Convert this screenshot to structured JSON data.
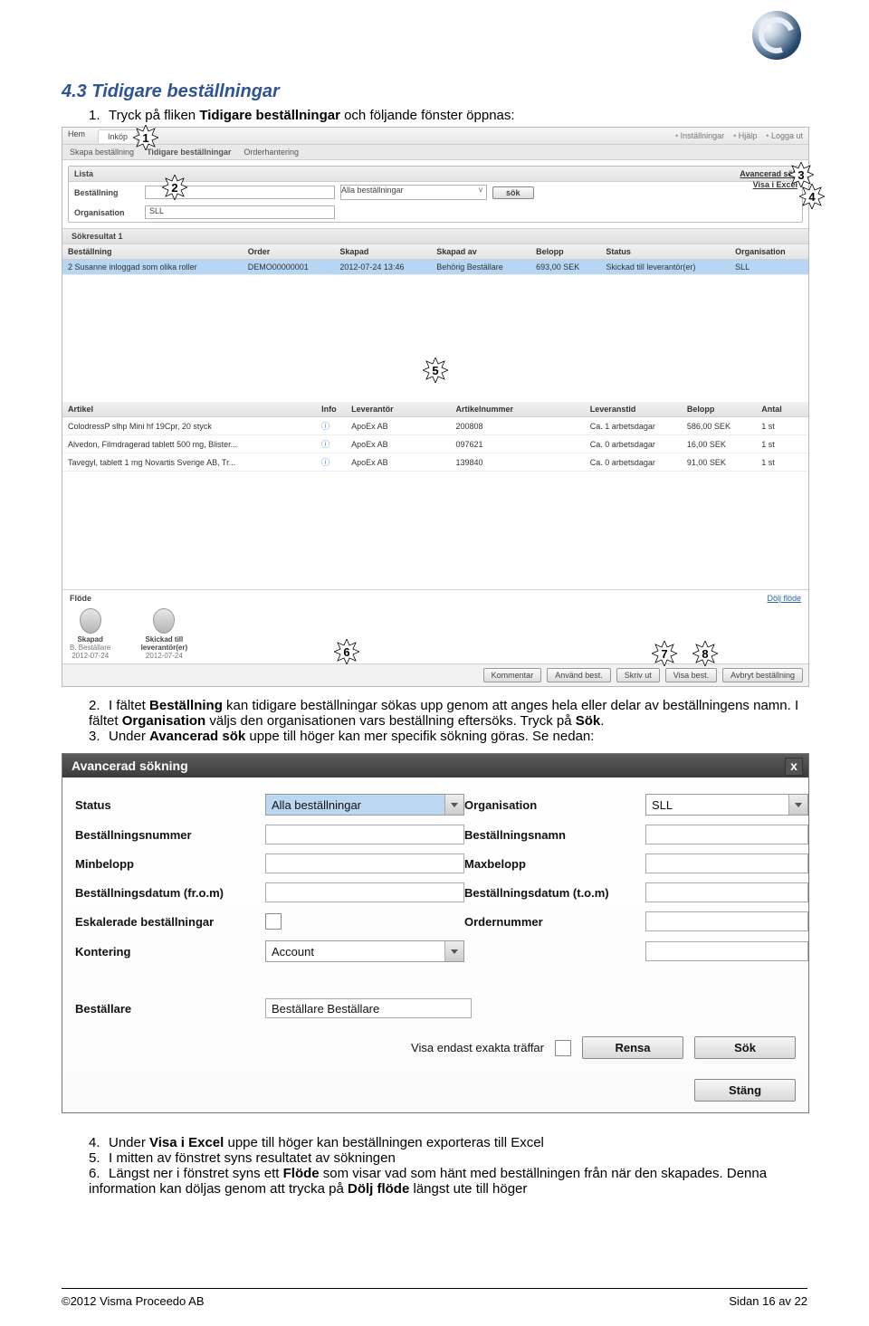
{
  "section_title": "4.3  Tidigare beställningar",
  "steps_top": [
    {
      "n": "1.",
      "pre": "Tryck på fliken ",
      "bold": "Tidigare beställningar",
      "post": " och följande fönster öppnas:"
    }
  ],
  "steps_mid": [
    {
      "n": "2.",
      "text": "I fältet {Beställning} kan tidigare beställningar sökas upp genom att anges hela eller delar av beställningens namn. I fältet {Organisation} väljs den organisationen vars beställning eftersöks. Tryck på {Sök}."
    },
    {
      "n": "3.",
      "text": "Under {Avancerad sök} uppe till höger kan mer specifik sökning göras. Se nedan:"
    }
  ],
  "steps_bottom": [
    {
      "n": "4.",
      "text": "Under {Visa i Excel} uppe till höger kan beställningen exporteras till Excel"
    },
    {
      "n": "5.",
      "text": "I mitten av fönstret syns resultatet av sökningen"
    },
    {
      "n": "6.",
      "text": "Längst ner i fönstret syns ett {Flöde} som visar vad som hänt med beställningen från när den skapades. Denna information kan döljas genom att trycka på {Dölj flöde} längst ute till höger"
    }
  ],
  "callouts": [
    "1",
    "2",
    "3",
    "4",
    "5",
    "6",
    "7",
    "8"
  ],
  "app": {
    "tabs": [
      "Hem",
      "Inköp"
    ],
    "topright": [
      "Inställningar",
      "Hjälp",
      "Logga ut"
    ],
    "crumbs": [
      "Skapa beställning",
      "Tidigare beställningar",
      "Orderhantering"
    ],
    "filter": {
      "title": "Lista",
      "bestallning_label": "Beställning",
      "org_label": "Organisation",
      "org_value": "SLL",
      "sel_placeholder": "Alla beställningar",
      "sok": "sök",
      "adv": "Avancerad sök",
      "excel": "Visa i Excel"
    },
    "results_label": "Sökresultat 1",
    "cols": [
      "Beställning",
      "Order",
      "Skapad",
      "Skapad av",
      "Belopp",
      "Status",
      "Organisation"
    ],
    "row": [
      "2 Susanne inloggad som olika roller",
      "DEMO00000001",
      "2012-07-24 13:46",
      "Behörig Beställare",
      "693,00 SEK",
      "Skickad till leverantör(er)",
      "SLL"
    ],
    "detail_cols": [
      "Artikel",
      "Info",
      "Leverantör",
      "Artikelnummer",
      "Leveranstid",
      "Belopp",
      "Antal"
    ],
    "detail_rows": [
      [
        "ColodressP slhp Mini hf 19Cpr, 20 styck",
        "ⓘ",
        "ApoEx AB",
        "200808",
        "Ca. 1 arbetsdagar",
        "586,00 SEK",
        "1 st"
      ],
      [
        "Alvedon, Filmdragerad tablett 500 mg, Blister...",
        "ⓘ",
        "ApoEx AB",
        "097621",
        "Ca. 0 arbetsdagar",
        "16,00 SEK",
        "1 st"
      ],
      [
        "Tavegyl, tablett 1 mg Novartis Sverige AB, Tr...",
        "ⓘ",
        "ApoEx AB",
        "139840",
        "Ca. 0 arbetsdagar",
        "91,00 SEK",
        "1 st"
      ]
    ],
    "flow_label": "Flöde",
    "flow_hide": "Dölj flöde",
    "flow_steps": [
      {
        "t": "Skapad",
        "s": "B. Beställare",
        "d": "2012-07-24"
      },
      {
        "t": "Skickad till leverantör(er)",
        "s": "",
        "d": "2012-07-24"
      }
    ],
    "actions": [
      "Kommentar",
      "Använd best.",
      "Skriv ut",
      "Visa best.",
      "Avbryt beställning"
    ]
  },
  "dialog": {
    "title": "Avancerad sökning",
    "rows": [
      [
        "Status",
        "sel:Alla beställningar",
        "Organisation",
        "sel:SLL"
      ],
      [
        "Beställningsnummer",
        "inp:",
        "Beställningsnamn",
        "inp:"
      ],
      [
        "Minbelopp",
        "inp:",
        "Maxbelopp",
        "inp:"
      ],
      [
        "Beställningsdatum (fr.o.m)",
        "inp:",
        "Beställningsdatum (t.o.m)",
        "inp:"
      ],
      [
        "Eskalerade beställningar",
        "chk:",
        "Ordernummer",
        "inp:"
      ],
      [
        "Kontering",
        "sel:Account",
        "",
        "inp:"
      ]
    ],
    "bestallare_label": "Beställare",
    "bestallare_value": "Beställare Beställare",
    "exact_label": "Visa endast exakta träffar",
    "rensa": "Rensa",
    "sok": "Sök",
    "stang": "Stäng"
  },
  "footer": {
    "left": "©2012 Visma Proceedo AB",
    "right": "Sidan 16 av 22"
  }
}
